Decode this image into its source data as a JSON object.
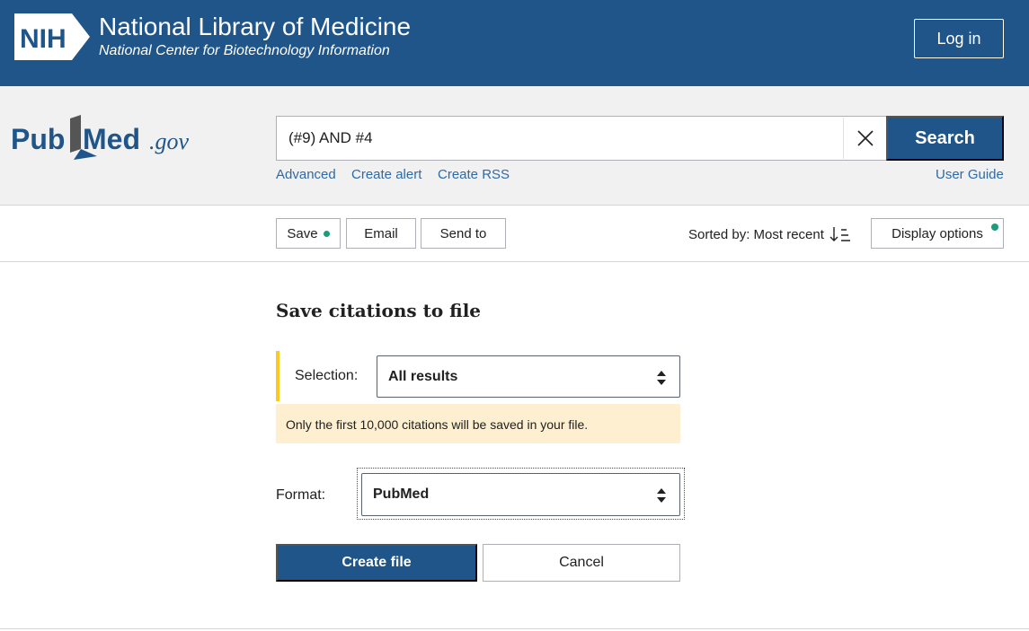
{
  "nih_header": {
    "logo_text": "NIH",
    "title": "National Library of Medicine",
    "subtitle": "National Center for Biotechnology Information",
    "login_label": "Log in"
  },
  "search": {
    "logo": {
      "pub": "Pub",
      "med": "Med",
      "gov": ".gov"
    },
    "query": "(#9) AND #4",
    "button_label": "Search",
    "links": {
      "advanced": "Advanced",
      "create_alert": "Create alert",
      "create_rss": "Create RSS",
      "user_guide": "User Guide"
    }
  },
  "toolbar": {
    "save_label": "Save",
    "email_label": "Email",
    "send_to_label": "Send to",
    "sorted_by": "Sorted by: Most recent",
    "display_options_label": "Display options"
  },
  "save_panel": {
    "title": "Save citations to file",
    "selection_label": "Selection:",
    "selection_value": "All results",
    "notice": "Only the first 10,000 citations will be saved in your file.",
    "format_label": "Format:",
    "format_value": "PubMed",
    "create_label": "Create file",
    "cancel_label": "Cancel"
  },
  "colors": {
    "brand_blue": "#20558a",
    "link_blue": "#2e6aa6",
    "notice_bg": "#fdefcf",
    "selection_accent": "#fac922",
    "status_dot": "#1d9b7c"
  },
  "icons": {
    "clear": "close-icon",
    "sort": "sort-descending-icon",
    "select": "select-arrows-icon"
  }
}
